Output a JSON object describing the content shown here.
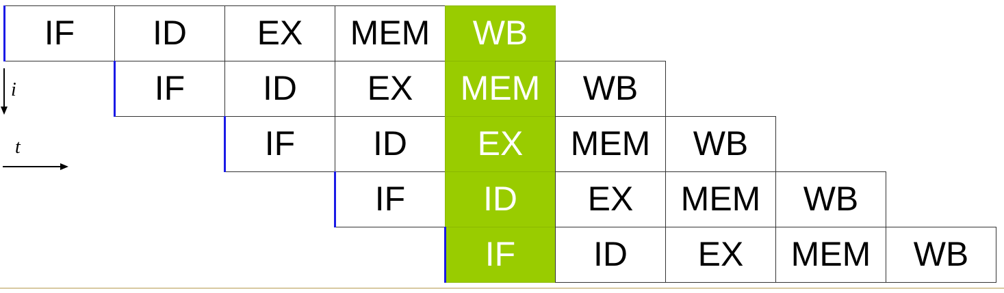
{
  "stages": [
    "IF",
    "ID",
    "EX",
    "MEM",
    "WB"
  ],
  "highlight_column": 4,
  "highlight_color": "#99cc00",
  "marker_color": "#1a1ae6",
  "axes": {
    "instruction_label": "i",
    "time_label": "t"
  }
}
